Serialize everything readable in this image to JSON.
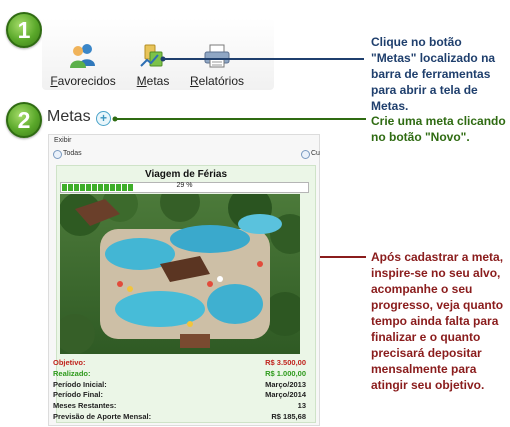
{
  "steps": [
    {
      "number": "1"
    },
    {
      "number": "2"
    }
  ],
  "toolbar": {
    "buttons": [
      {
        "label": "Favorecidos",
        "icon": "users-icon"
      },
      {
        "label": "Metas",
        "icon": "goals-icon"
      },
      {
        "label": "Relatórios",
        "icon": "printer-icon"
      }
    ]
  },
  "notes": {
    "step1": "Clique no botão \"Metas\" localizado na barra de ferramentas para abrir a tela de Metas.",
    "step2": "Crie uma meta clicando no botão \"Novo\".",
    "goal": "Após cadastrar a meta, inspire-se no seu alvo, acompanhe o seu progresso, veja quanto tempo ainda falta para finalizar e o quanto precisará depositar mensalmente para atingir seu objetivo."
  },
  "metas": {
    "title": "Metas",
    "new_button": "+",
    "filter": {
      "label": "Exibir",
      "option_all": "Todas",
      "option_other": "Cu"
    },
    "goal": {
      "name": "Viagem de Férias",
      "progress_percent": 29,
      "progress_text": "29 %",
      "rows": [
        {
          "label": "Objetivo:",
          "value": "R$ 3.500,00",
          "color": "#c0231d"
        },
        {
          "label": "Realizado:",
          "value": "R$ 1.000,00",
          "color": "#2e9a1c"
        },
        {
          "label": "Período Inicial:",
          "value": "Março/2013",
          "color": "#222222"
        },
        {
          "label": "Período Final:",
          "value": "Março/2014",
          "color": "#222222"
        },
        {
          "label": "Meses Restantes:",
          "value": "13",
          "color": "#222222"
        },
        {
          "label": "Previsão de Aporte Mensal:",
          "value": "R$ 185,68",
          "color": "#222222"
        }
      ]
    }
  },
  "colors": {
    "note_blue": "#1f3f6d",
    "note_green": "#2f6b12",
    "note_red": "#8a1c1c",
    "step_badge": "#5aa82a"
  }
}
